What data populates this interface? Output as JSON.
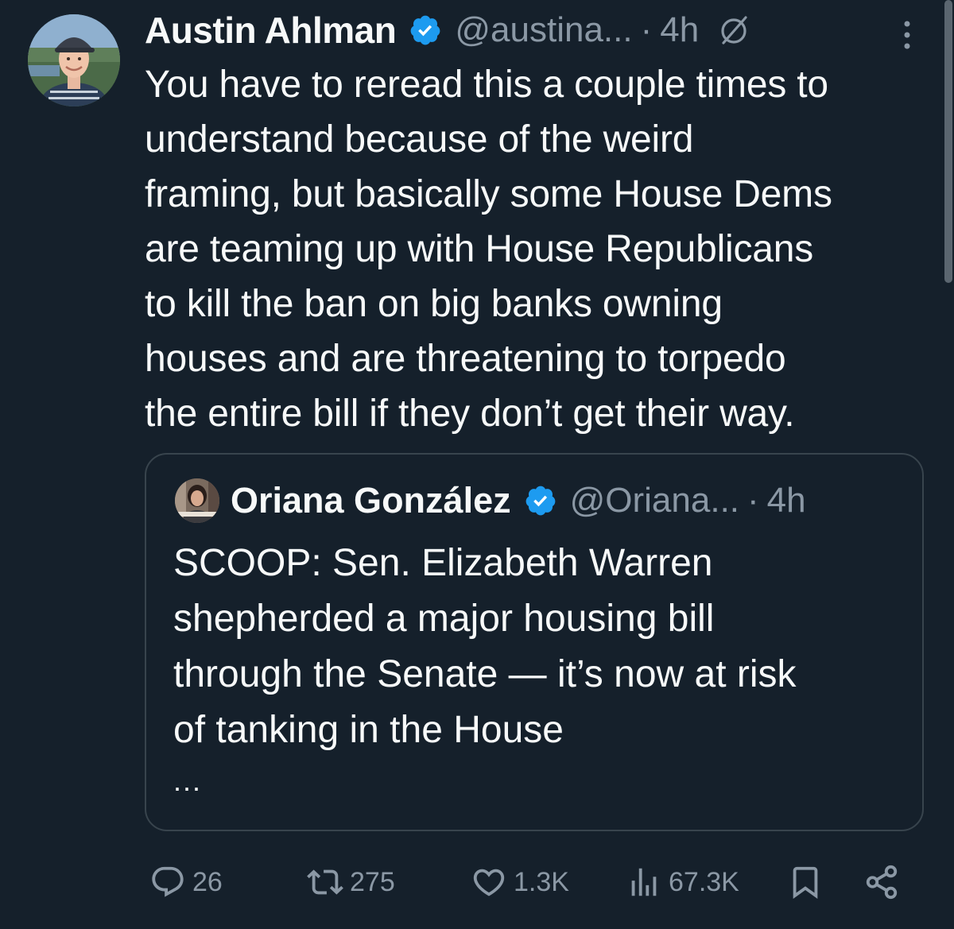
{
  "author": {
    "name": "Austin Ahlman",
    "handle": "@austina...",
    "separator": "·",
    "time": "4h"
  },
  "tweet": {
    "text": "You have to reread this a couple times to\nunderstand because of the weird\nframing, but basically some House Dems\nare teaming up with House Republicans\nto kill the ban on big banks owning\nhouses and are threatening to torpedo\nthe entire bill if they don’t get their way."
  },
  "quote": {
    "name": "Oriana González",
    "handle": "@Oriana...",
    "separator": "·",
    "time": "4h",
    "text": "SCOOP: Sen. Elizabeth Warren\nshepherded a major housing bill\nthrough the Senate — it’s now at risk\nof tanking in the House",
    "ellipsis": "..."
  },
  "actions": {
    "replies": "26",
    "reposts": "275",
    "likes": "1.3K",
    "views": "67.3K"
  },
  "colors": {
    "background": "#15202b",
    "text": "#f7f9f9",
    "secondary": "#8b98a5",
    "verified": "#1d9bf0",
    "border": "#38444d"
  },
  "icons": [
    "verified-badge-icon",
    "grok-icon",
    "more-icon",
    "reply-icon",
    "repost-icon",
    "like-icon",
    "views-icon",
    "bookmark-icon",
    "share-icon"
  ]
}
